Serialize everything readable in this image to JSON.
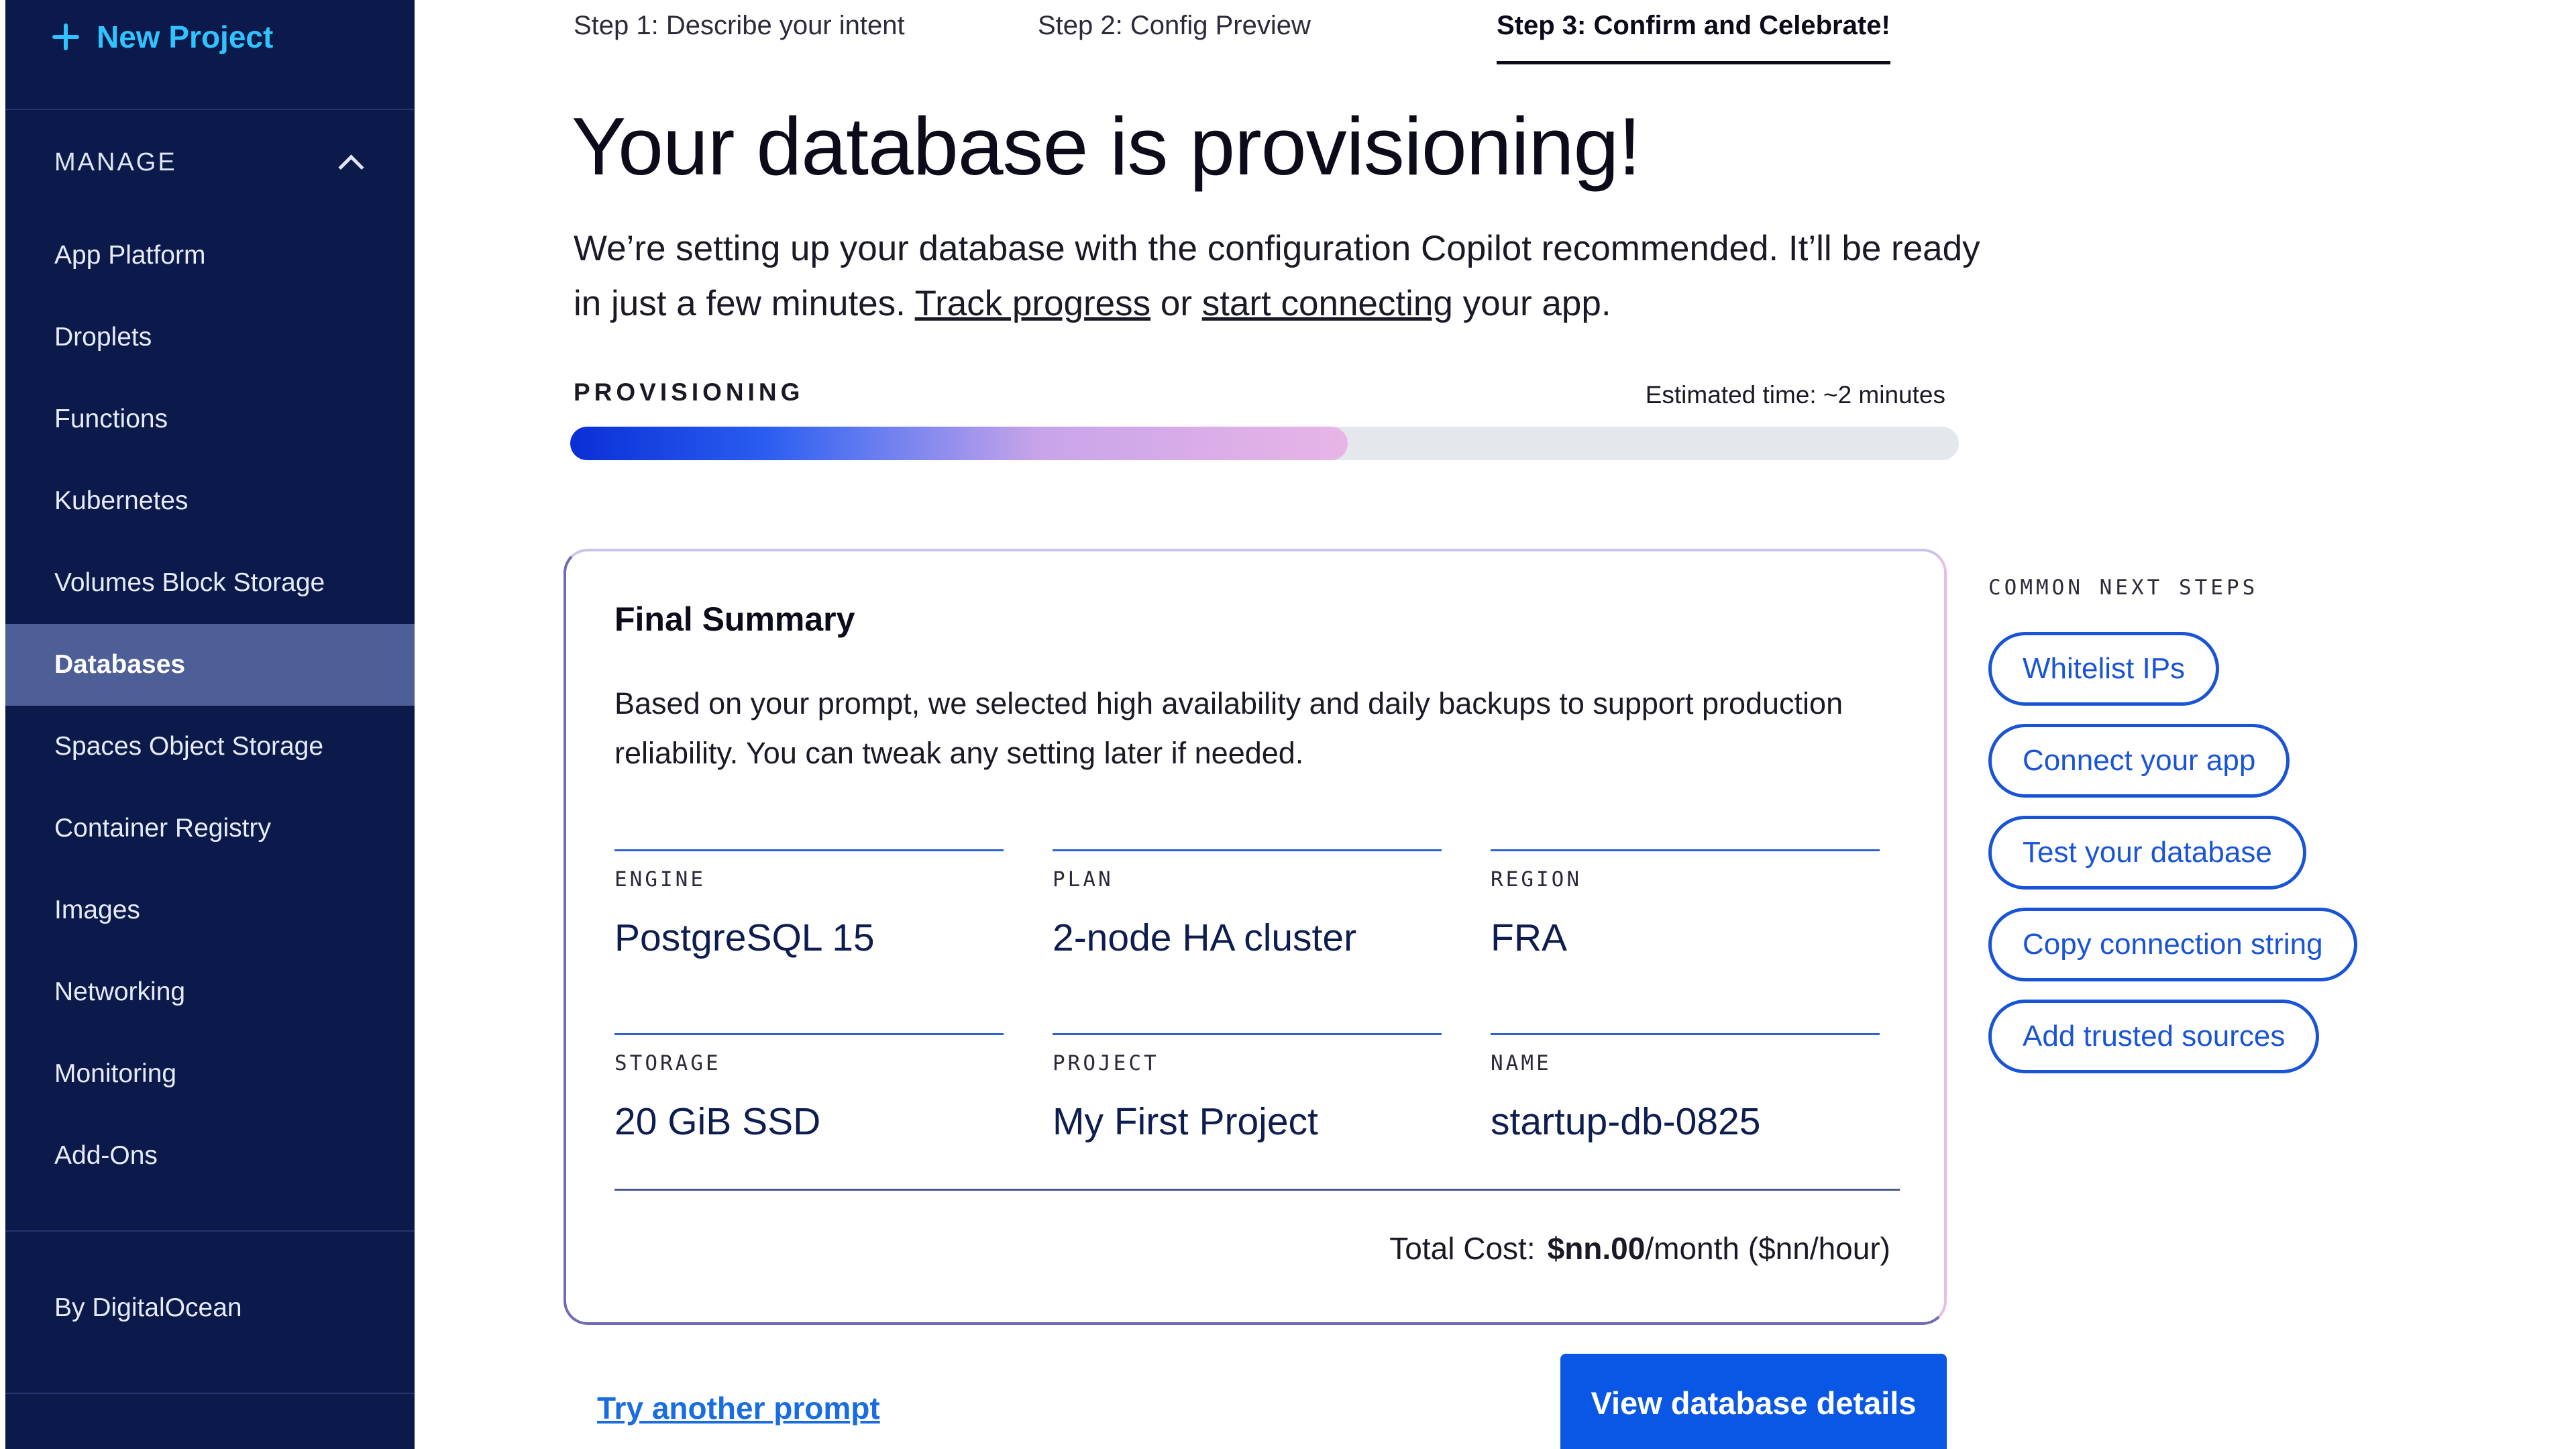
{
  "sidebar": {
    "new_project_label": "New Project",
    "manage_label": "MANAGE",
    "items": [
      {
        "label": "App Platform"
      },
      {
        "label": "Droplets"
      },
      {
        "label": "Functions"
      },
      {
        "label": "Kubernetes"
      },
      {
        "label": "Volumes Block Storage"
      },
      {
        "label": "Databases",
        "active": true
      },
      {
        "label": "Spaces Object Storage"
      },
      {
        "label": "Container Registry"
      },
      {
        "label": "Images"
      },
      {
        "label": "Networking"
      },
      {
        "label": "Monitoring"
      },
      {
        "label": "Add-Ons"
      }
    ],
    "footer_label": "By DigitalOcean"
  },
  "steps": [
    {
      "label": "Step 1: Describe your intent"
    },
    {
      "label": "Step 2: Config Preview"
    },
    {
      "label": "Step 3: Confirm and Celebrate!",
      "active": true
    }
  ],
  "main": {
    "title": "Your database is provisioning!",
    "intro_before": "We’re setting up your database with the configuration Copilot recommended. It’ll be ready in just a few minutes. ",
    "track_link": "Track progress",
    "intro_middle": " or ",
    "connect_link": "start connecting",
    "intro_after": " your app."
  },
  "progress": {
    "label": "PROVISIONING",
    "estimate": "Estimated time: ~2 minutes",
    "percent": 56
  },
  "summary": {
    "title": "Final Summary",
    "description": "Based on your prompt, we selected high availability and daily backups to support production reliability. You can tweak any setting later if needed.",
    "fields": [
      {
        "label": "ENGINE",
        "value": "PostgreSQL 15"
      },
      {
        "label": "PLAN",
        "value": "2-node HA cluster"
      },
      {
        "label": "REGION",
        "value": "FRA"
      },
      {
        "label": "STORAGE",
        "value": "20 GiB SSD"
      },
      {
        "label": "PROJECT",
        "value": "My First Project"
      },
      {
        "label": "NAME",
        "value": "startup-db-0825"
      }
    ],
    "total_label": "Total Cost:",
    "total_amount": "$nn.00",
    "total_suffix": "/month ($nn/hour)"
  },
  "next_steps": {
    "label": "COMMON NEXT STEPS",
    "items": [
      {
        "label": "Whitelist IPs"
      },
      {
        "label": "Connect your app"
      },
      {
        "label": "Test your database"
      },
      {
        "label": "Copy connection string"
      },
      {
        "label": "Add trusted sources"
      }
    ]
  },
  "actions": {
    "try_another": "Try another prompt",
    "view_details": "View database details"
  },
  "colors": {
    "sidebar_bg": "#0b1a4a",
    "accent_cyan": "#2fc3ff",
    "primary_blue": "#0a57e6",
    "active_nav": "#4d5f96"
  }
}
